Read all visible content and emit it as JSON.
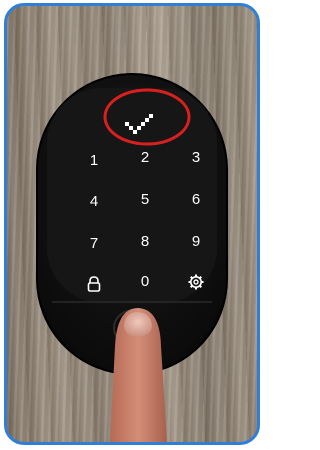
{
  "keypad": {
    "keys": [
      "1",
      "2",
      "3",
      "4",
      "5",
      "6",
      "7",
      "8",
      "9",
      "0"
    ],
    "lock_icon": "lock-icon",
    "settings_icon": "gear-icon",
    "status_icon": "checkmark-icon"
  },
  "annotation": {
    "highlight_color": "#d9201e",
    "frame_color": "#2f7fd6"
  }
}
